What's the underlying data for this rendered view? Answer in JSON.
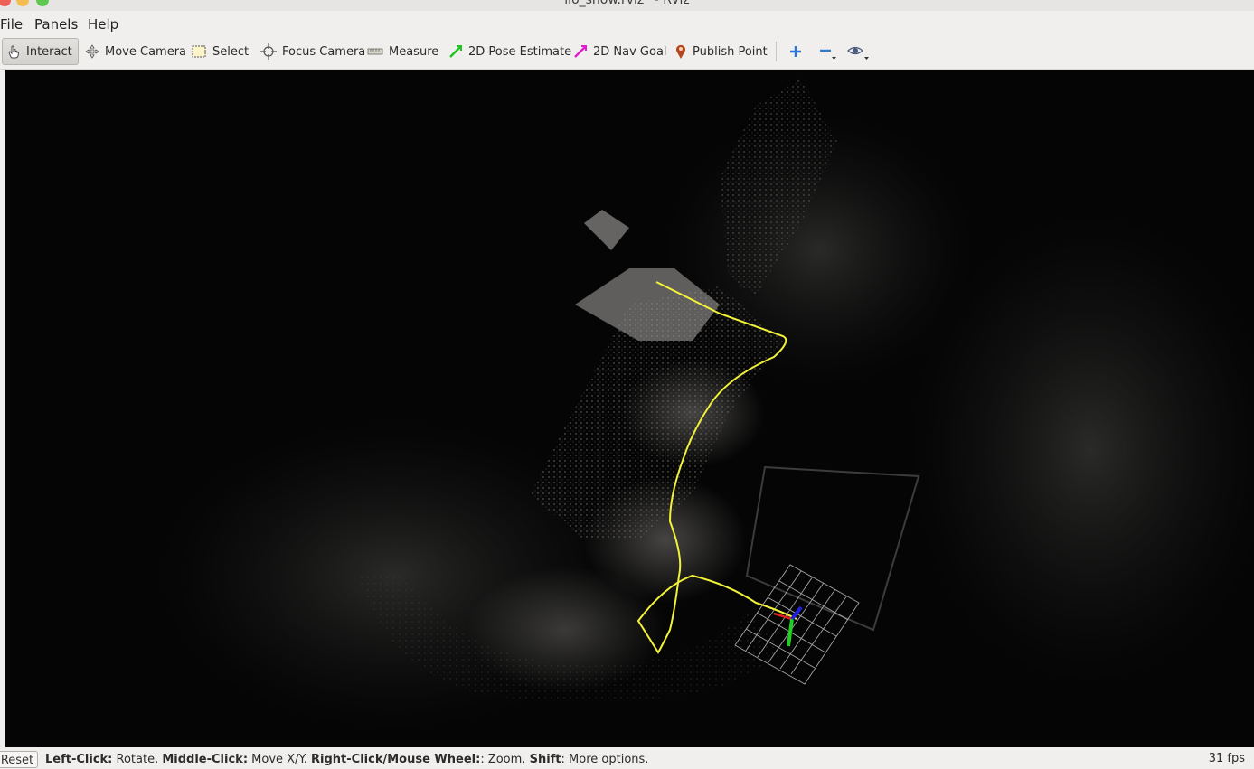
{
  "window": {
    "title": "lio_show.rviz* - RViz"
  },
  "menu": {
    "file": "File",
    "panels": "Panels",
    "help": "Help"
  },
  "toolbar": {
    "interact": "Interact",
    "move_camera": "Move Camera",
    "select": "Select",
    "focus_camera": "Focus Camera",
    "measure": "Measure",
    "pose_estimate": "2D Pose Estimate",
    "nav_goal": "2D Nav Goal",
    "publish_point": "Publish Point",
    "add_icon": "plus-icon",
    "remove_icon": "minus-icon",
    "view_icon": "eye-icon"
  },
  "viewport": {
    "background": "#050505",
    "trajectory_color": "#f2f23a",
    "grid_color": "#cfcfcf",
    "axis_colors": {
      "x": "#e02020",
      "y": "#20d020",
      "z": "#2020e0"
    }
  },
  "status": {
    "reset": "Reset",
    "left_click_key": "Left-Click:",
    "left_click_val": " Rotate.",
    "middle_click_key": "Middle-Click:",
    "middle_click_val": " Move X/Y.",
    "right_click_key": "Right-Click/Mouse Wheel:",
    "right_click_val": ": Zoom.",
    "shift_key": "Shift",
    "shift_val": ": More options.",
    "fps": "31 fps"
  }
}
